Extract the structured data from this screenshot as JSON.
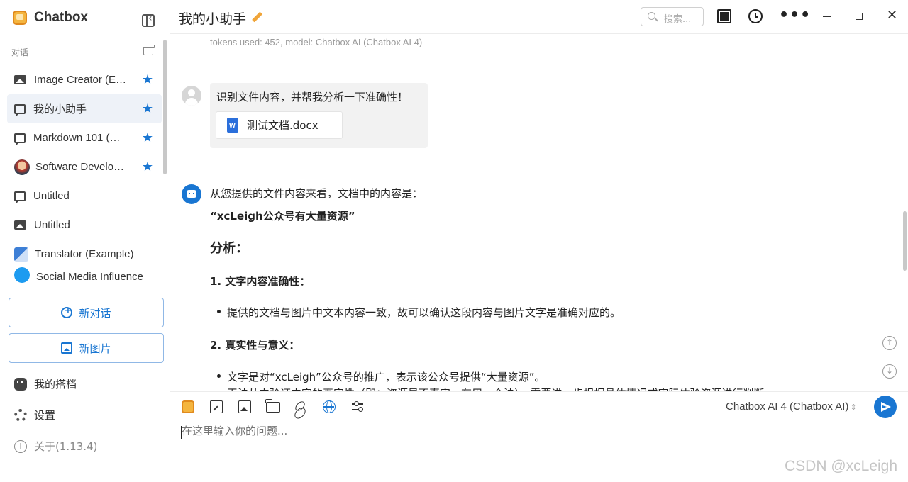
{
  "app": {
    "name": "Chatbox"
  },
  "sidebar": {
    "section_label": "对话",
    "conversations": [
      {
        "label": "Image Creator (E…",
        "icon": "image-icon",
        "starred": true,
        "active": false
      },
      {
        "label": "我的小助手",
        "icon": "chat-icon",
        "starred": true,
        "active": true
      },
      {
        "label": "Markdown 101 (…",
        "icon": "chat-icon",
        "starred": true,
        "active": false
      },
      {
        "label": "Software Develo…",
        "icon": "avatar-icon",
        "starred": true,
        "active": false
      },
      {
        "label": "Untitled",
        "icon": "chat-icon",
        "starred": false,
        "active": false
      },
      {
        "label": "Untitled",
        "icon": "image-icon",
        "starred": false,
        "active": false
      },
      {
        "label": "Translator (Example)",
        "icon": "translate-icon",
        "starred": false,
        "active": false
      },
      {
        "label": "Social Media Influence",
        "icon": "twitter-icon",
        "starred": false,
        "active": false
      }
    ],
    "new_chat_label": "新对话",
    "new_image_label": "新图片",
    "copilots_label": "我的搭档",
    "settings_label": "设置",
    "about_label": "关于(1.13.4)"
  },
  "header": {
    "title": "我的小助手",
    "search_placeholder": "搜索..."
  },
  "messages": {
    "token_info": "tokens used: 452, model: Chatbox AI (Chatbox AI 4)",
    "user": {
      "text": "识别文件内容，并帮我分析一下准确性！",
      "attachment": "测试文档.docx"
    },
    "assistant": {
      "intro": "从您提供的文件内容来看，文档中的内容是：",
      "quote": "“xcLeigh公众号有大量资源”",
      "analysis_heading": "分析：",
      "point1_heading": "1. 文字内容准确性：",
      "point1_bullet": "提供的文档与图片中文本内容一致，故可以确认这段内容与图片文字是准确对应的。",
      "point2_heading": "2. 真实性与意义：",
      "point2_bullet": "文字是对“xcLeigh”公众号的推广，表示该公众号提供“大量资源”。",
      "point2_bullet_cont": "无法从中验证内容的真实性（即：资源是否真实、有用、合法），需要进一步根据具体情况或实际体验资源进行判断。"
    }
  },
  "composer": {
    "model_label": "Chatbox AI 4 (Chatbox AI)",
    "placeholder": "在这里输入你的问题..."
  },
  "watermark": "CSDN @xcLeigh",
  "colors": {
    "accent": "#1976d2",
    "active_bg": "#eef2f8",
    "user_bubble": "#f2f2f2"
  }
}
